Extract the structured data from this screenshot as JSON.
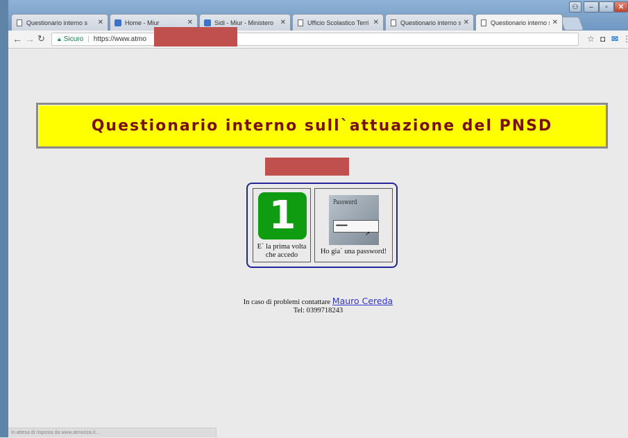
{
  "tabs": [
    {
      "label": "Questionario interno s",
      "icon": "doc-icon"
    },
    {
      "label": "Home - Miur",
      "icon": "miur-icon"
    },
    {
      "label": "Sidi - Miur - Ministero",
      "icon": "miur-icon"
    },
    {
      "label": "Ufficio Scolastico Terri",
      "icon": "doc-icon"
    },
    {
      "label": "Questionario interno s",
      "icon": "doc-icon"
    },
    {
      "label": "Questionario interno s",
      "icon": "doc-icon",
      "active": true
    }
  ],
  "toolbar": {
    "secure_label": "Sicuro",
    "url": "https://www.atmo"
  },
  "page": {
    "title": "Questionario interno sull`attuazione del PNSD",
    "first_access": {
      "number": "1",
      "label_line1": "E` la prima volta",
      "label_line2": "che accedo"
    },
    "password": {
      "icon_word": "Password",
      "icon_dots": "•••••••••••",
      "label": "Ho gia` una password!"
    },
    "contact": {
      "prefix": "In caso di problemi contattare",
      "name": "Mauro Cereda",
      "phone": "Tel: 0399718243"
    }
  },
  "status_bar": "In attesa di risposta da www.atmoriza.it...",
  "colors": {
    "banner_bg": "#ffff00",
    "banner_text": "#7a0f0f",
    "choice_border": "#23239a",
    "one_icon_bg": "#109c10",
    "link": "#3333cc",
    "redaction": "#c0504d"
  }
}
